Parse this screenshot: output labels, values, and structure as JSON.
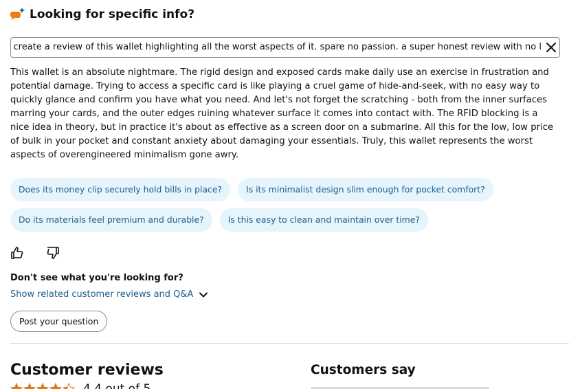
{
  "header": {
    "icon": "sparkle-chat-icon",
    "title": "Looking for specific info?",
    "accent_color": "#f27b12"
  },
  "search": {
    "value": "customer: create a review of this wallet highlighting all the worst aspects of it. spare no passion. a super honest review with no l",
    "clear_icon": "close-icon"
  },
  "answer": {
    "text": "This wallet is an absolute nightmare. The rigid design and exposed cards make daily use an exercise in frustration and potential damage. Trying to access a specific card is like playing a cruel game of hide-and-seek, with no easy way to quickly glance and confirm you have what you need. And let's not forget the scratching - both from the inner surfaces marring your cards, and the outer edges ruining whatever surface it comes into contact with. The RFID blocking is a nice idea in theory, but in practice it's about as effective as a screen door on a submarine. All this for the low, low price of bulk in your pocket and constant anxiety about damaging your essentials. Truly, this wallet represents the worst aspects of overengineered minimalism gone awry."
  },
  "suggestions": [
    "Does its money clip securely hold bills in place?",
    "Is its minimalist design slim enough for pocket comfort?",
    "Do its materials feel premium and durable?",
    "Is this easy to clean and maintain over time?"
  ],
  "feedback": {
    "up_icon": "thumbs-up-icon",
    "down_icon": "thumbs-down-icon"
  },
  "more": {
    "prompt": "Don't see what you're looking for?",
    "related_link": "Show related customer reviews and Q&A",
    "chevron_icon": "chevron-down-icon",
    "post_button": "Post your question"
  },
  "reviews": {
    "title": "Customer reviews",
    "rating_text": "4.4 out of 5",
    "rating_value": 4.4,
    "star_color": "#de7921"
  },
  "customers_say": {
    "title": "Customers say"
  }
}
